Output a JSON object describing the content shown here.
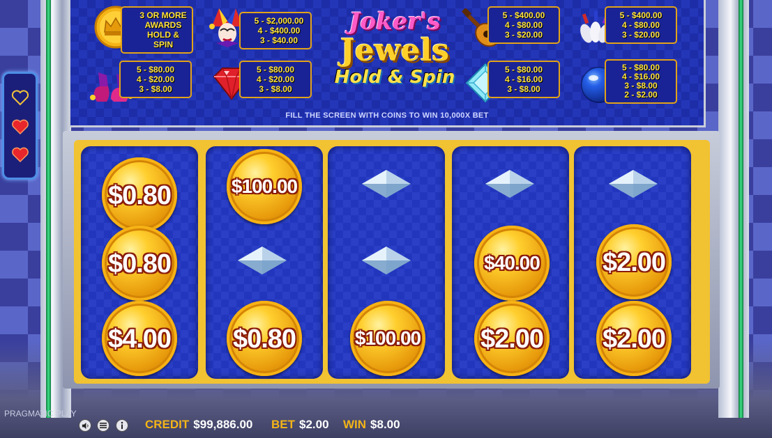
{
  "game": {
    "title_line1": "Joker's",
    "title_line2": "Jewels",
    "title_line3": "Hold & Spin"
  },
  "paytable": {
    "footer": "FILL THE SCREEN WITH COINS TO WIN 10,000X BET",
    "crown": [
      "3 OR MORE",
      "AWARDS",
      "HOLD &",
      "SPIN"
    ],
    "joker": [
      "5 - $2,000.00",
      "4 - $400.00",
      "3 - $40.00"
    ],
    "lute": [
      "5 - $400.00",
      "4 - $80.00",
      "3 - $20.00"
    ],
    "pins": [
      "5 - $400.00",
      "4 - $80.00",
      "3 - $20.00"
    ],
    "shoes": [
      "5 - $80.00",
      "4 - $20.00",
      "3 - $8.00"
    ],
    "ruby": [
      "5 - $80.00",
      "4 - $20.00",
      "3 - $8.00"
    ],
    "diamond": [
      "5 - $80.00",
      "4 - $16.00",
      "3 - $8.00"
    ],
    "ball": [
      "5 - $80.00",
      "4 - $16.00",
      "3 - $8.00",
      "2 - $2.00"
    ]
  },
  "reels": {
    "r1": [
      "$0.80",
      "$0.80",
      "$4.00"
    ],
    "r2": [
      "$100.00",
      "",
      "$0.80"
    ],
    "r3": [
      "",
      "",
      "$100.00"
    ],
    "r4": [
      "",
      "$40.00",
      "$2.00"
    ],
    "r5": [
      "",
      "$2.00",
      "$2.00"
    ]
  },
  "status": {
    "brand": "PRAGMATIC PLAY",
    "credit_label": "CREDIT",
    "credit_value": "$99,886.00",
    "bet_label": "BET",
    "bet_value": "$2.00",
    "win_label": "WIN",
    "win_value": "$8.00"
  },
  "colors": {
    "gold": "#f3b417",
    "reel_blue": "#2236bd",
    "heart_red": "#e8262b"
  },
  "lives": {
    "total": 3,
    "lost": 1
  }
}
